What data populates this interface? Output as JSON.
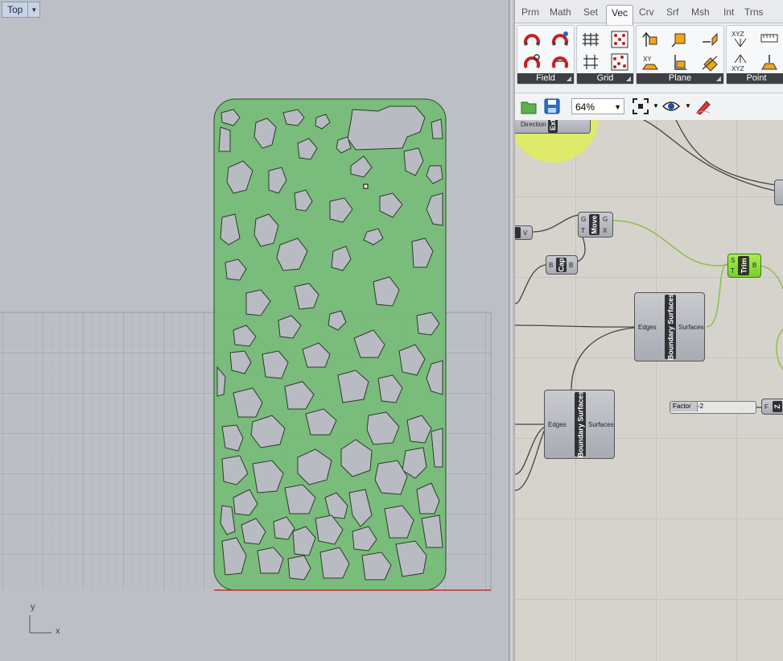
{
  "viewport": {
    "label": "Top",
    "axis_y": "y",
    "axis_x": "x"
  },
  "grasshopper": {
    "tabs": [
      {
        "label": "Prm",
        "active": false
      },
      {
        "label": "Math",
        "active": false
      },
      {
        "label": "Set",
        "active": false
      },
      {
        "label": "Vec",
        "active": true
      },
      {
        "label": "Crv",
        "active": false
      },
      {
        "label": "Srf",
        "active": false
      },
      {
        "label": "Msh",
        "active": false
      },
      {
        "label": "Int",
        "active": false
      },
      {
        "label": "Trns",
        "active": false
      }
    ],
    "ribbon_groups": [
      {
        "label": "Field"
      },
      {
        "label": "Grid"
      },
      {
        "label": "Plane"
      },
      {
        "label": "Point"
      }
    ],
    "toolbar": {
      "zoom": "64%"
    },
    "components": {
      "extrude_partial": {
        "input": "Direction",
        "core": "Ext"
      },
      "move": {
        "core": "Move",
        "in_g": "G",
        "in_t": "T",
        "out_g": "G",
        "out_x": "X"
      },
      "cap": {
        "core": "Cap",
        "in_b": "B",
        "out_b": "B"
      },
      "trim": {
        "core": "Trim",
        "in_s": "S",
        "in_t": "T",
        "out_b": "B"
      },
      "boundary1": {
        "core": "Boundary Surfaces",
        "input": "Edges",
        "output": "Surfaces"
      },
      "boundary2": {
        "core": "Boundary Surfaces",
        "input": "Edges",
        "output": "Surfaces"
      },
      "vec_partial": {
        "out_v": "V"
      },
      "factor_slider": {
        "label": "Factor",
        "value": "-2"
      },
      "z_partial": {
        "in_f": "F",
        "core": "Z"
      }
    }
  },
  "colors": {
    "viewport_bg": "#bcc0c6",
    "phone_fill": "#74bc74",
    "canvas_bg": "#d6d3cc",
    "wire_selected": "#8cc04a",
    "ghost_circle": "#dfe96a"
  }
}
